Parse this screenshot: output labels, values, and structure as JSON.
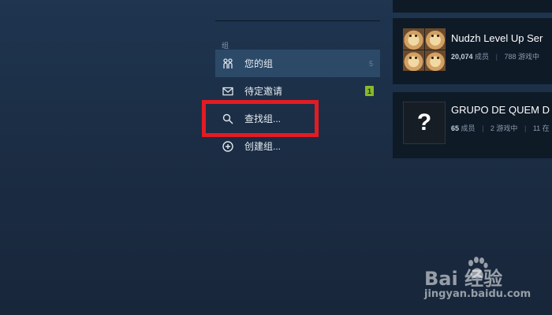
{
  "sidebar": {
    "section_label": "组",
    "items": [
      {
        "label": "您的组",
        "count": "5",
        "icon": "users-icon"
      },
      {
        "label": "待定邀请",
        "badge": "1",
        "icon": "mail-icon"
      },
      {
        "label": "查找组...",
        "icon": "search-icon"
      },
      {
        "label": "创建组...",
        "icon": "plus-circle-icon"
      }
    ]
  },
  "groups": [
    {
      "name": "Nudzh Level Up Ser",
      "members_num": "20,074",
      "members_label": "成员",
      "ingame": "788 游戏中",
      "avatar": "doge-grid"
    },
    {
      "name": "GRUPO DE QUEM D",
      "members_num": "65",
      "members_label": "成员",
      "ingame": "2 游戏中",
      "online": "11 在",
      "avatar_glyph": "?"
    }
  ],
  "watermark": {
    "logo": "Bai  经验",
    "url": "jingyan.baidu.com"
  },
  "colors": {
    "highlight": "#e31b23",
    "badge": "#8ab82a",
    "active_bg": "#2c4a68"
  }
}
